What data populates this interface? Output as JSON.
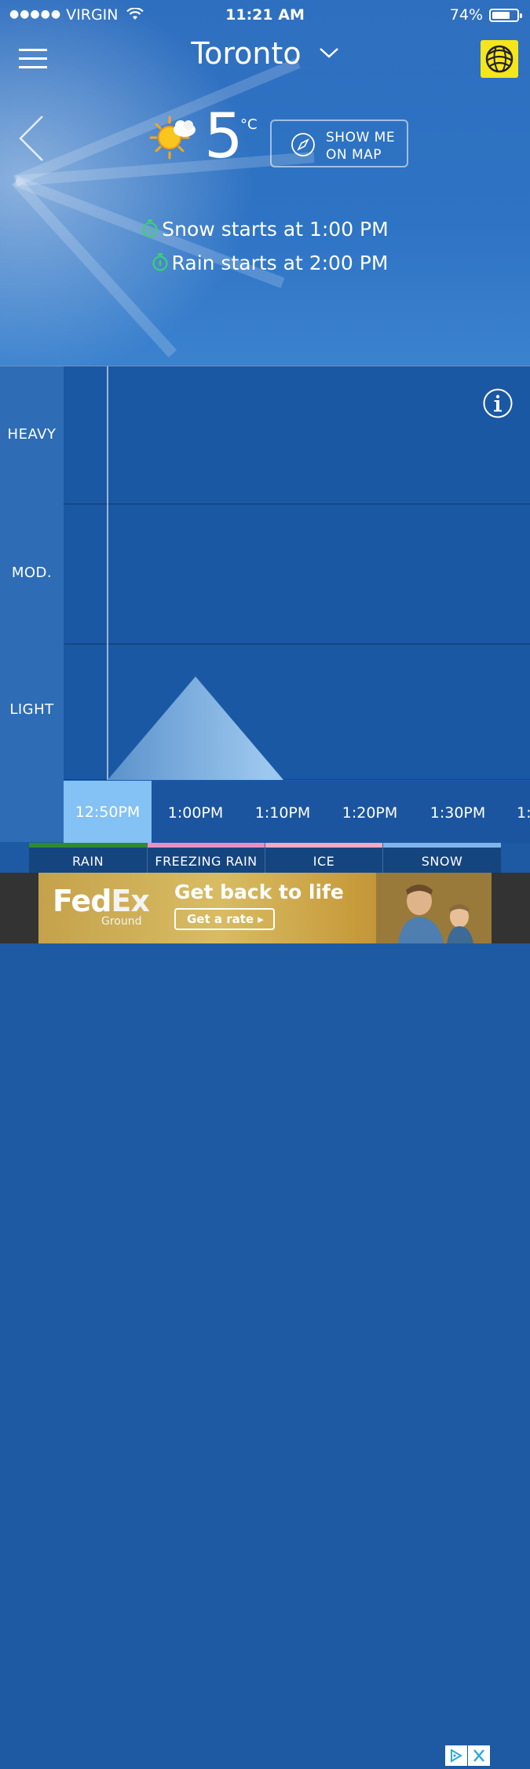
{
  "status_bar": {
    "signal_dots": "●●●●●",
    "carrier": "VIRGIN",
    "time": "11:21 AM",
    "battery": "74%",
    "battery_level": 0.74
  },
  "header": {
    "city": "Toronto"
  },
  "current": {
    "temperature": "5",
    "unit": "°C",
    "map_button": "SHOW ME\nON MAP"
  },
  "alerts": [
    "Snow starts at 1:00 PM",
    "Rain starts at 2:00 PM"
  ],
  "chart": {
    "intensity_levels": [
      "HEAVY",
      "MOD.",
      "LIGHT"
    ],
    "time_labels": [
      "12:50PM",
      "1:00PM",
      "1:10PM",
      "1:20PM",
      "1:30PM",
      "1:"
    ],
    "active_time": "12:50PM"
  },
  "chart_data": {
    "type": "area",
    "x": [
      "12:50PM",
      "1:00PM",
      "1:10PM",
      "1:20PM",
      "1:30PM"
    ],
    "series": [
      {
        "values": [
          0,
          0.75,
          0,
          0,
          0
        ]
      }
    ],
    "y_levels": [
      "LIGHT",
      "MOD.",
      "HEAVY"
    ],
    "ylim": [
      0,
      3
    ]
  },
  "legend": [
    {
      "label": "RAIN",
      "color": "#2e8b2e"
    },
    {
      "label": "FREEZING RAIN",
      "color": "#e88fc4"
    },
    {
      "label": "ICE",
      "color": "#f2aac6"
    },
    {
      "label": "SNOW",
      "color": "#7eb6ea"
    }
  ],
  "ad": {
    "brand_fed": "Fed",
    "brand_ex": "Ex",
    "brand_sub": "Ground",
    "tagline": "Get back to life",
    "cta": "Get a rate ▸"
  },
  "colors": {
    "accent_green": "#3bd16f",
    "logo_yellow": "#f5e51b"
  }
}
